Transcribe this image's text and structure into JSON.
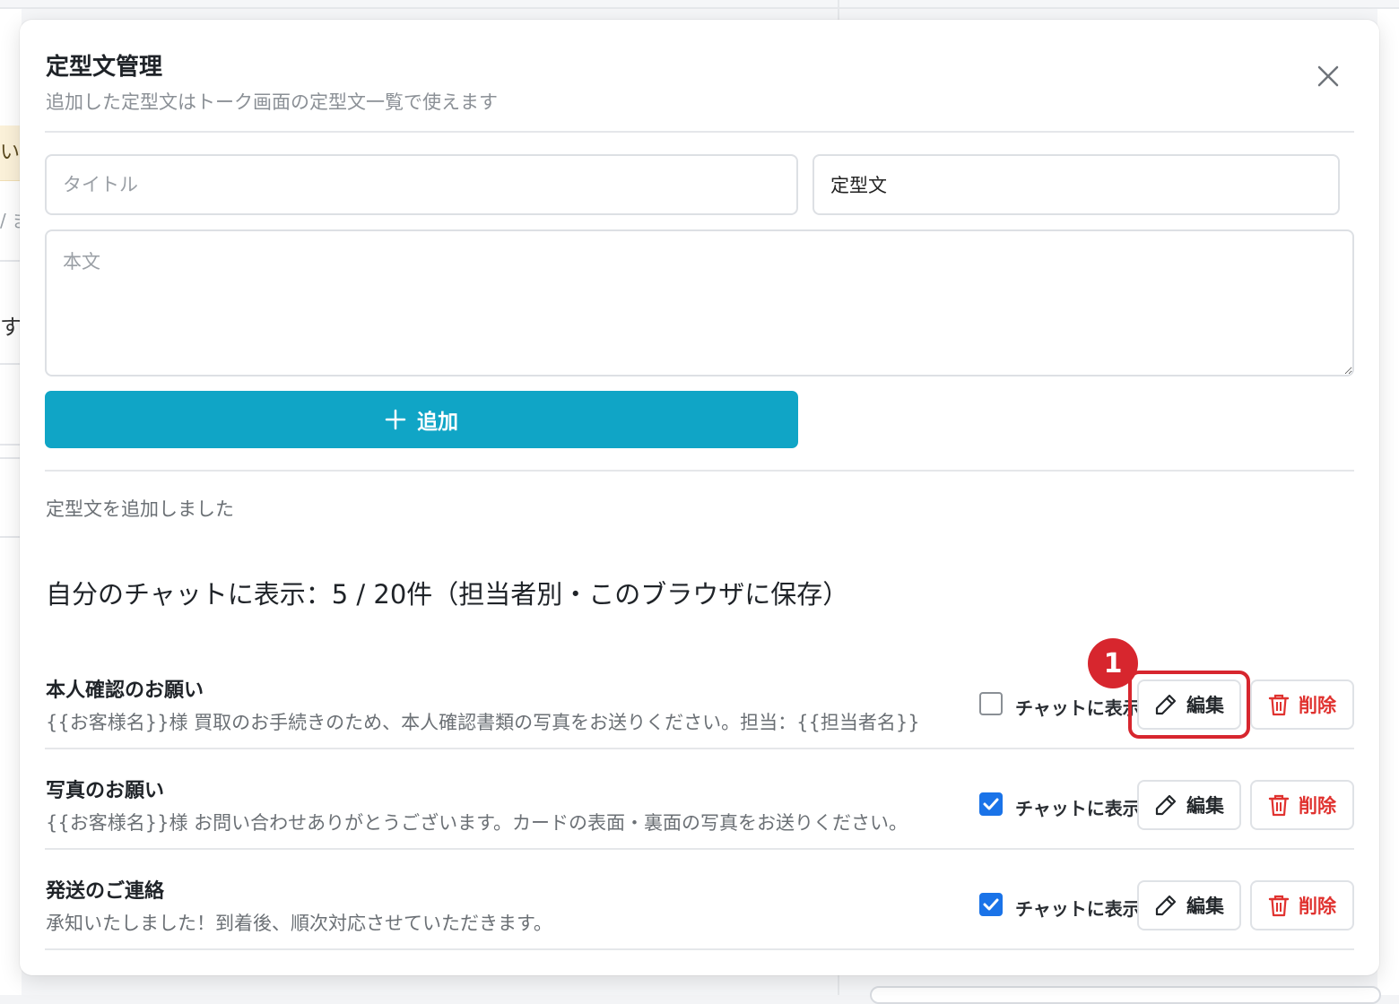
{
  "background": {
    "warn_fragment": "い。",
    "slash_fragment": "/ ま",
    "row_fragment": "す"
  },
  "modal": {
    "title": "定型文管理",
    "subtitle": "追加した定型文はトーク画面の定型文一覧で使えます",
    "close_icon": "close-icon"
  },
  "form": {
    "title_placeholder": "タイトル",
    "category_value": "定型文",
    "body_placeholder": "本文",
    "add_label": "追加",
    "add_icon": "plus-icon",
    "accent_color": "#10a5c6"
  },
  "status_message": "定型文を追加しました",
  "count_line": "自分のチャットに表示：5 / 20件（担当者別・このブラウザに保存）",
  "templates": [
    {
      "name": "本人確認のお願い",
      "body": "{{お客様名}}様 買取のお手続きのため、本人確認書類の写真をお送りください。担当：{{担当者名}}",
      "show_in_chat": false,
      "show_label": "チャットに表示",
      "edit_label": "編集",
      "delete_label": "削除"
    },
    {
      "name": "写真のお願い",
      "body": "{{お客様名}}様 お問い合わせありがとうございます。カードの表面・裏面の写真をお送りください。",
      "show_in_chat": true,
      "show_label": "チャットに表示",
      "edit_label": "編集",
      "delete_label": "削除"
    },
    {
      "name": "発送のご連絡",
      "body": "承知いたしました！到着後、順次対応させていただきます。",
      "show_in_chat": true,
      "show_label": "チャットに表示",
      "edit_label": "編集",
      "delete_label": "削除"
    }
  ],
  "annotation": {
    "marker_label": "1",
    "color": "#d7262e"
  },
  "colors": {
    "delete": "#e0322f",
    "checkbox_checked": "#1a73e8"
  }
}
